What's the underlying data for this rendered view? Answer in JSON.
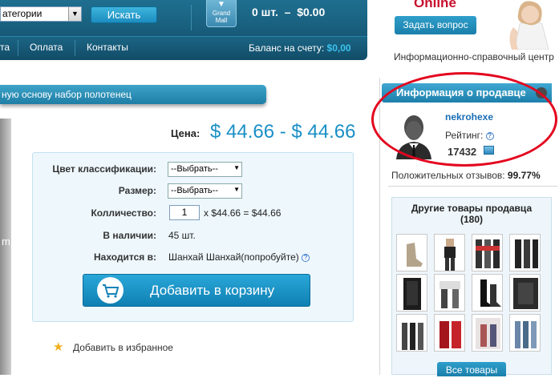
{
  "header": {
    "category_select": "атегории",
    "search_button": "Искать",
    "grand_mall_line1": "Grand",
    "grand_mall_line2": "Mall",
    "cart_summary": "0 шт.  –  $0.00"
  },
  "nav": {
    "items": [
      "та",
      "Оплата",
      "Контакты"
    ],
    "balance_label": "Баланс на счету:",
    "balance_value": "$0,00"
  },
  "support": {
    "online_label": "Online",
    "ask_button": "Задать вопрос",
    "info_center": "Информационно-справочный центр"
  },
  "product": {
    "title": "ную основу набор полотенец",
    "image_fragment": "m",
    "price_label": "Цена:",
    "price_value": "$ 44.66 - $ 44.66"
  },
  "options": {
    "color_label": "Цвет классификации:",
    "color_value": "--Выбрать--",
    "size_label": "Размер:",
    "size_value": "--Выбрать--",
    "qty_label": "Колличество:",
    "qty_value": "1",
    "qty_calc": "x $44.66 = $44.66",
    "stock_label": "В наличии:",
    "stock_value": "45 шт.",
    "location_label": "Находится в:",
    "location_value": "Шанхай Шанхай(попробуйте)",
    "add_to_cart": "Добавить в корзину",
    "add_favorite": "Добавить в избранное"
  },
  "seller": {
    "header": "Информация о продавце",
    "name": "nekrohexe",
    "rating_label": "Рейтинг:",
    "rating_value": "17432",
    "positive_label": "Положительных отзывов:",
    "positive_value": "99.77%",
    "other_title_line1": "Другие товары продавца",
    "other_title_line2": "(180)",
    "all_button": "Все товары"
  },
  "colors": {
    "accent": "#1a8fc6",
    "header_bg": "#175a78",
    "highlight": "#e3061f"
  }
}
